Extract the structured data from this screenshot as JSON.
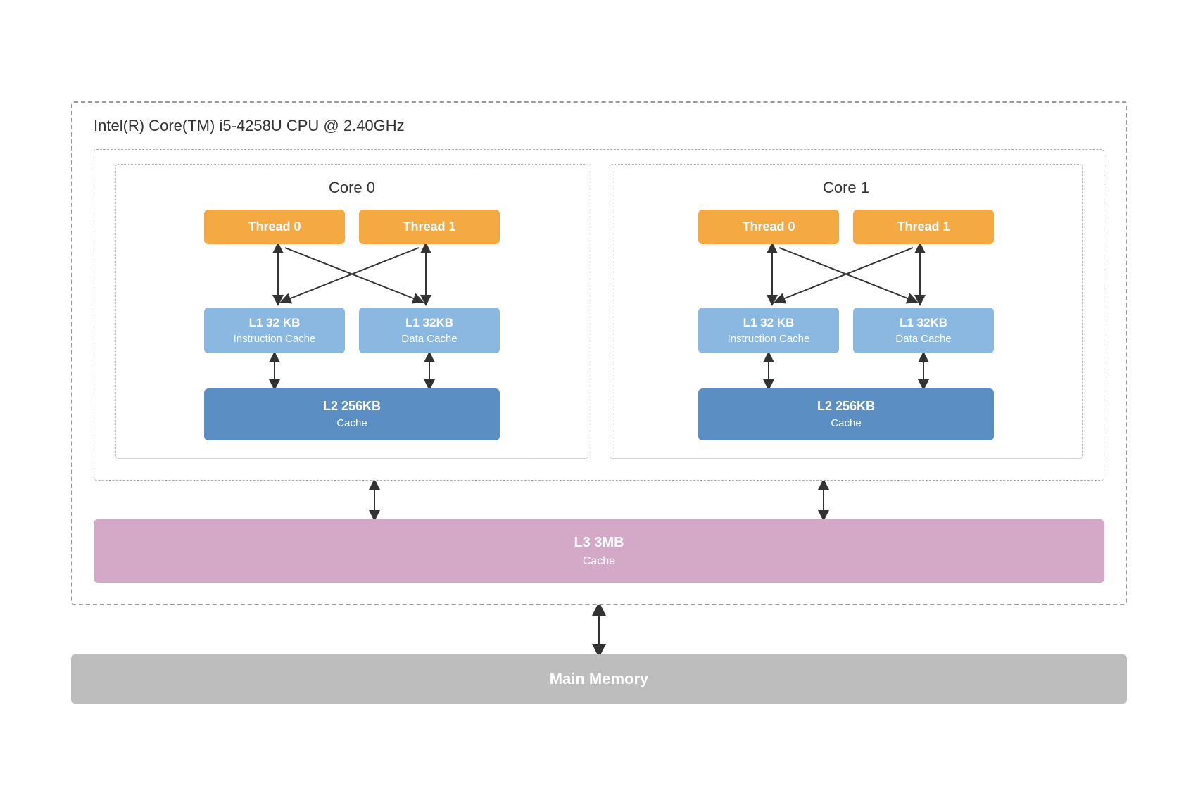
{
  "cpu": {
    "title": "Intel(R) Core(TM) i5-4258U CPU @ 2.40GHz",
    "cores": [
      {
        "label": "Core 0",
        "threads": [
          "Thread 0",
          "Thread 1"
        ],
        "l1_instruction": {
          "name": "L1 32 KB",
          "sub": "Instruction Cache"
        },
        "l1_data": {
          "name": "L1 32KB",
          "sub": "Data Cache"
        },
        "l2": {
          "name": "L2 256KB",
          "sub": "Cache"
        }
      },
      {
        "label": "Core 1",
        "threads": [
          "Thread 0",
          "Thread 1"
        ],
        "l1_instruction": {
          "name": "L1 32 KB",
          "sub": "Instruction Cache"
        },
        "l1_data": {
          "name": "L1 32KB",
          "sub": "Data Cache"
        },
        "l2": {
          "name": "L2 256KB",
          "sub": "Cache"
        }
      }
    ],
    "l3": {
      "name": "L3 3MB",
      "sub": "Cache"
    },
    "main_memory": "Main Memory"
  }
}
